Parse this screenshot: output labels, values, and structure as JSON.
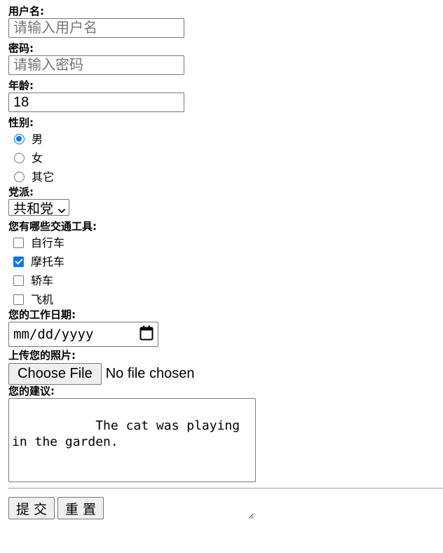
{
  "username": {
    "label": "用户名:",
    "placeholder": "请输入用户名",
    "value": ""
  },
  "password": {
    "label": "密码:",
    "placeholder": "请输入密码",
    "value": ""
  },
  "age": {
    "label": "年龄:",
    "value": "18"
  },
  "gender": {
    "label": "性别:",
    "options": [
      {
        "label": "男",
        "checked": true
      },
      {
        "label": "女",
        "checked": false
      },
      {
        "label": "其它",
        "checked": false
      }
    ]
  },
  "party": {
    "label": "党派:",
    "selected": "共和党"
  },
  "vehicles": {
    "label": "您有哪些交通工具:",
    "options": [
      {
        "label": "自行车",
        "checked": false
      },
      {
        "label": "摩托车",
        "checked": true
      },
      {
        "label": "轿车",
        "checked": false
      },
      {
        "label": "飞机",
        "checked": false
      }
    ]
  },
  "work_date": {
    "label": "您的工作日期:",
    "placeholder": "mm/dd/yyyy"
  },
  "photo": {
    "label": "上传您的照片:",
    "button": "Choose File",
    "status": "No file chosen"
  },
  "suggestion": {
    "label": "您的建议:",
    "value": "       The cat was playing in the garden."
  },
  "actions": {
    "submit": "提 交",
    "reset": "重 置"
  },
  "colors": {
    "accent": "#0075ff",
    "border": "#767676",
    "button_bg": "#efefef"
  },
  "icons": {
    "date_picker": "calendar-icon",
    "select_caret": "chevron-down-icon",
    "textarea_resize": "resize-grip-icon"
  }
}
